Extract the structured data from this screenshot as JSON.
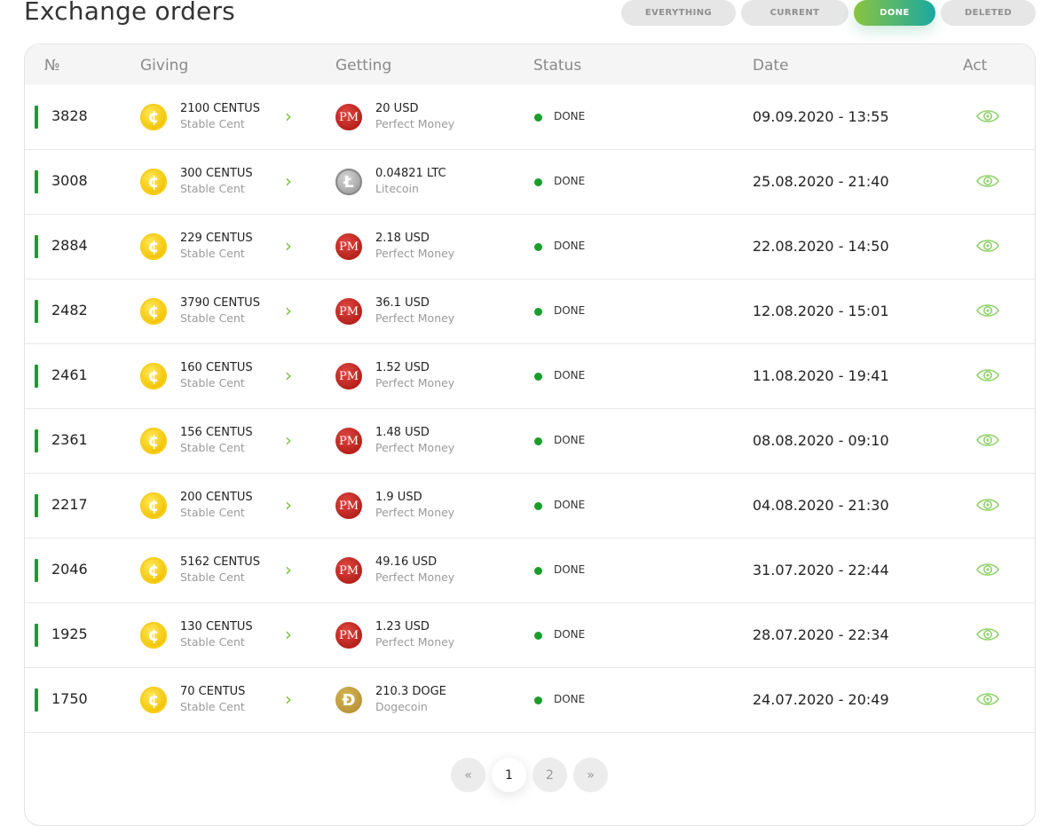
{
  "title": "Exchange orders",
  "filters": {
    "everything": "EVERYTHING",
    "current": "CURRENT",
    "done": "DONE",
    "deleted": "DELETED",
    "active": "done"
  },
  "columns": {
    "no": "№",
    "giving": "Giving",
    "getting": "Getting",
    "status": "Status",
    "date": "Date",
    "act": "Act"
  },
  "colors": {
    "accent_green": "#1a9d2b",
    "arrow_green": "#7ac142"
  },
  "orders": [
    {
      "id": "3828",
      "give_amount": "2100 CENTUS",
      "give_name": "Stable Cent",
      "give_icon": "centus-coin-icon",
      "get_amount": "20 USD",
      "get_name": "Perfect Money",
      "get_icon": "perfect-money-icon",
      "status": "DONE",
      "date": "09.09.2020 - 13:55"
    },
    {
      "id": "3008",
      "give_amount": "300 CENTUS",
      "give_name": "Stable Cent",
      "give_icon": "centus-coin-icon",
      "get_amount": "0.04821 LTC",
      "get_name": "Litecoin",
      "get_icon": "litecoin-icon",
      "status": "DONE",
      "date": "25.08.2020 - 21:40"
    },
    {
      "id": "2884",
      "give_amount": "229 CENTUS",
      "give_name": "Stable Cent",
      "give_icon": "centus-coin-icon",
      "get_amount": "2.18 USD",
      "get_name": "Perfect Money",
      "get_icon": "perfect-money-icon",
      "status": "DONE",
      "date": "22.08.2020 - 14:50"
    },
    {
      "id": "2482",
      "give_amount": "3790 CENTUS",
      "give_name": "Stable Cent",
      "give_icon": "centus-coin-icon",
      "get_amount": "36.1 USD",
      "get_name": "Perfect Money",
      "get_icon": "perfect-money-icon",
      "status": "DONE",
      "date": "12.08.2020 - 15:01"
    },
    {
      "id": "2461",
      "give_amount": "160 CENTUS",
      "give_name": "Stable Cent",
      "give_icon": "centus-coin-icon",
      "get_amount": "1.52 USD",
      "get_name": "Perfect Money",
      "get_icon": "perfect-money-icon",
      "status": "DONE",
      "date": "11.08.2020 - 19:41"
    },
    {
      "id": "2361",
      "give_amount": "156 CENTUS",
      "give_name": "Stable Cent",
      "give_icon": "centus-coin-icon",
      "get_amount": "1.48 USD",
      "get_name": "Perfect Money",
      "get_icon": "perfect-money-icon",
      "status": "DONE",
      "date": "08.08.2020 - 09:10"
    },
    {
      "id": "2217",
      "give_amount": "200 CENTUS",
      "give_name": "Stable Cent",
      "give_icon": "centus-coin-icon",
      "get_amount": "1.9 USD",
      "get_name": "Perfect Money",
      "get_icon": "perfect-money-icon",
      "status": "DONE",
      "date": "04.08.2020 - 21:30"
    },
    {
      "id": "2046",
      "give_amount": "5162 CENTUS",
      "give_name": "Stable Cent",
      "give_icon": "centus-coin-icon",
      "get_amount": "49.16 USD",
      "get_name": "Perfect Money",
      "get_icon": "perfect-money-icon",
      "status": "DONE",
      "date": "31.07.2020 - 22:44"
    },
    {
      "id": "1925",
      "give_amount": "130 CENTUS",
      "give_name": "Stable Cent",
      "give_icon": "centus-coin-icon",
      "get_amount": "1.23 USD",
      "get_name": "Perfect Money",
      "get_icon": "perfect-money-icon",
      "status": "DONE",
      "date": "28.07.2020 - 22:34"
    },
    {
      "id": "1750",
      "give_amount": "70 CENTUS",
      "give_name": "Stable Cent",
      "give_icon": "centus-coin-icon",
      "get_amount": "210.3 DOGE",
      "get_name": "Dogecoin",
      "get_icon": "dogecoin-icon",
      "status": "DONE",
      "date": "24.07.2020 - 20:49"
    }
  ],
  "pagination": {
    "prev": "«",
    "pages": [
      "1",
      "2"
    ],
    "current": "1",
    "next": "»"
  }
}
